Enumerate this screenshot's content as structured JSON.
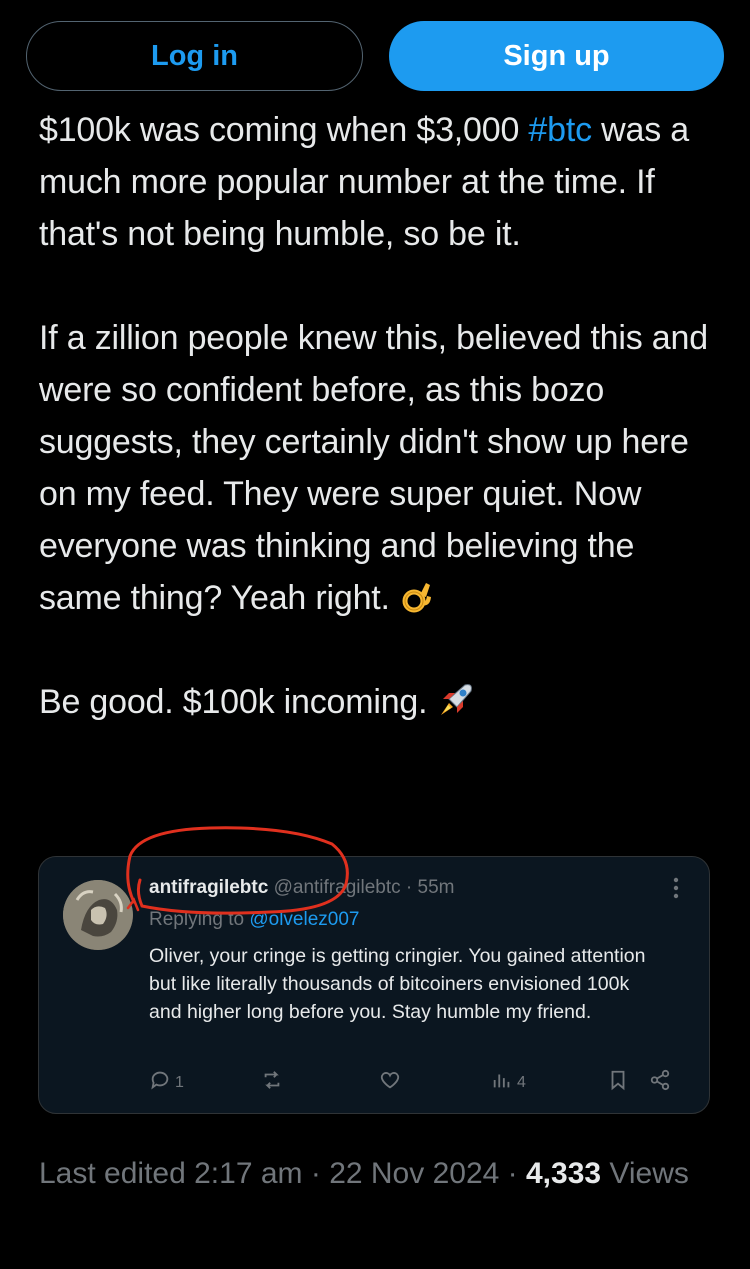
{
  "auth": {
    "login_label": "Log in",
    "signup_label": "Sign up"
  },
  "tweet": {
    "p1_part1": "$100k was coming when $3,000 ",
    "p1_hashtag": "#btc",
    "p1_part2": " was a much more popular number at the time. If that's not being humble, so be it.",
    "p2": "If a zillion people knew this, believed this and were so confident before, as this bozo suggests, they certainly didn't show up here on my feed. They were super quiet. Now everyone was thinking and believing the same thing? Yeah right.",
    "p3": "Be good. $100k incoming.",
    "emoji_ok_icon": "ok-hand-emoji",
    "emoji_rocket_icon": "rocket-emoji"
  },
  "quote": {
    "name": "antifragilebtc",
    "handle": "@antifragilebtc",
    "separator": "·",
    "time": "55m",
    "replying_prefix": "Replying to ",
    "replying_to": "@olvelez007",
    "text": "Oliver, your cringe is getting cringier. You gained attention but like literally thousands of bitcoiners envisioned 100k and higher long before you. Stay humble my friend.",
    "reply_count": "1",
    "views_count": "4",
    "more_icon": "more-vertical-icon"
  },
  "meta": {
    "edited_label": "Last edited 2:17 am",
    "dot1": " · ",
    "date": "22 Nov 2024",
    "dot2": " · ",
    "views_count": "4,333",
    "views_label": "Views"
  },
  "colors": {
    "accent": "#1d9bf0",
    "annotation": "#e0301e",
    "muted": "#71767b",
    "text": "#e7e9ea"
  }
}
